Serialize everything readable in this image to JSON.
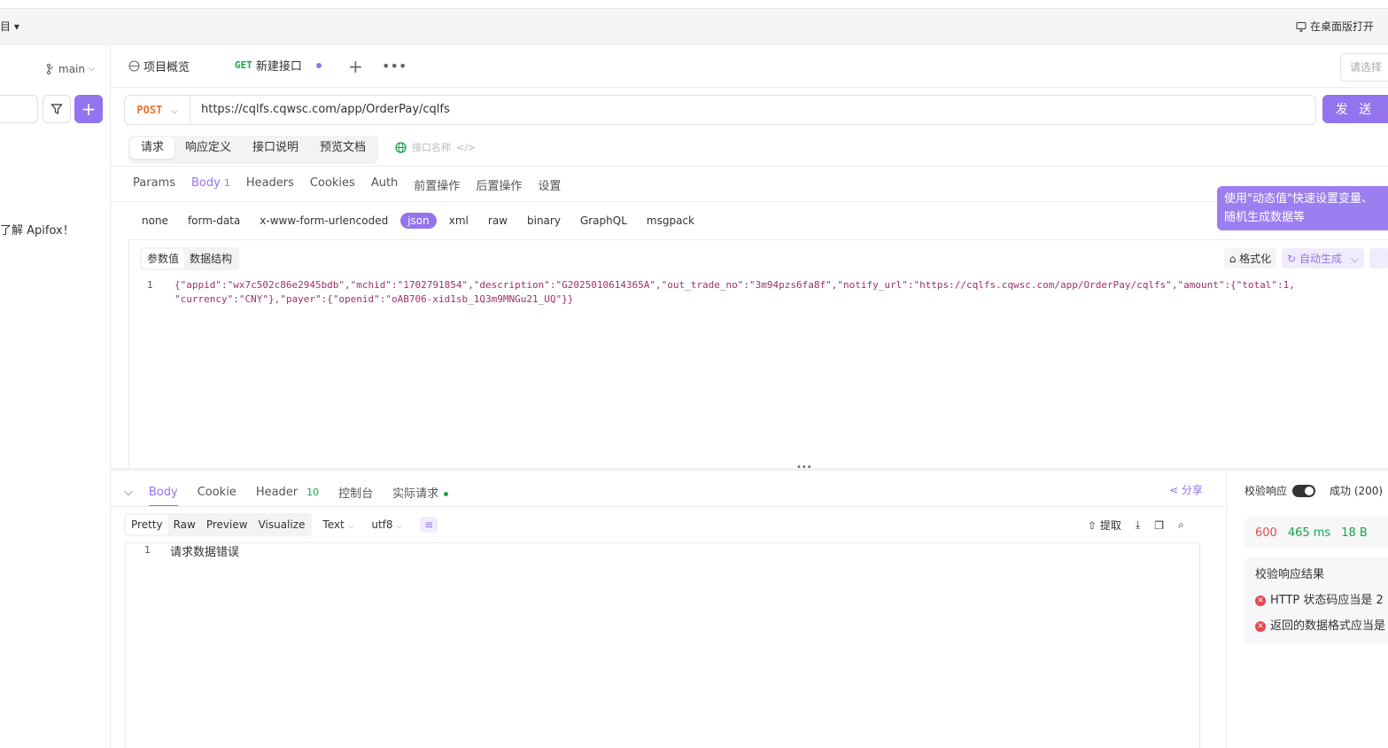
{
  "titlebar": {
    "left_text": "目 ▾",
    "open_desktop": "在桌面版打开"
  },
  "sidebar": {
    "branch": "main",
    "message": "了解 Apifox！"
  },
  "tabs": {
    "overview": "项目概览",
    "active_method": "GET",
    "active_label": "新建接口",
    "select_placeholder": "请选择"
  },
  "request": {
    "method": "POST",
    "url": "https://cqlfs.cqwsc.com/app/OrderPay/cqlfs",
    "send": "发 送"
  },
  "segments": [
    "请求",
    "响应定义",
    "接口说明",
    "预览文档"
  ],
  "api_name_placeholder": "接口名称",
  "subtabs": [
    {
      "label": "Params"
    },
    {
      "label": "Body",
      "count": "1"
    },
    {
      "label": "Headers"
    },
    {
      "label": "Cookies"
    },
    {
      "label": "Auth"
    },
    {
      "label": "前置操作"
    },
    {
      "label": "后置操作"
    },
    {
      "label": "设置"
    }
  ],
  "body_types": [
    "none",
    "form-data",
    "x-www-form-urlencoded",
    "json",
    "xml",
    "raw",
    "binary",
    "GraphQL",
    "msgpack"
  ],
  "tooltip": "使用\"动态值\"快速设置变量、随机生成数据等",
  "editor": {
    "tabs": [
      "参数值",
      "数据结构"
    ],
    "format": "格式化",
    "auto": "自动生成",
    "line1_num": "1",
    "line1": "{\"appid\":\"wx7c502c86e2945bdb\",\"mchid\":\"1702791854\",\"description\":\"G2025010614365A\",\"out_trade_no\":\"3m94pzs6fa8f\",\"notify_url\":\"https://cqlfs.cqwsc.com/app/OrderPay/cqlfs\",\"amount\":{\"total\":1,",
    "line2": "\"currency\":\"CNY\"},\"payer\":{\"openid\":\"oAB706-xid1sb_1Q3m9MNGu21_UQ\"}}"
  },
  "response": {
    "tabs": [
      {
        "label": "Body"
      },
      {
        "label": "Cookie"
      },
      {
        "label": "Header",
        "count": "10"
      },
      {
        "label": "控制台"
      },
      {
        "label": "实际请求"
      }
    ],
    "share": "分享",
    "views": [
      "Pretty",
      "Raw",
      "Preview",
      "Visualize"
    ],
    "text_select": "Text",
    "encoding": "utf8",
    "extract": "提取",
    "line_num": "1",
    "content": "请求数据错误"
  },
  "panel": {
    "validate_label": "校验响应",
    "status": "成功 (200)",
    "code": "600",
    "time": "465 ms",
    "size": "18 B",
    "result_title": "校验响应结果",
    "errors": [
      "HTTP 状态码应当是 2",
      "返回的数据格式应当是"
    ]
  },
  "colors": {
    "accent": "#9373ee",
    "post": "#e8742f",
    "get": "#17a34a",
    "error": "#e5484d"
  }
}
